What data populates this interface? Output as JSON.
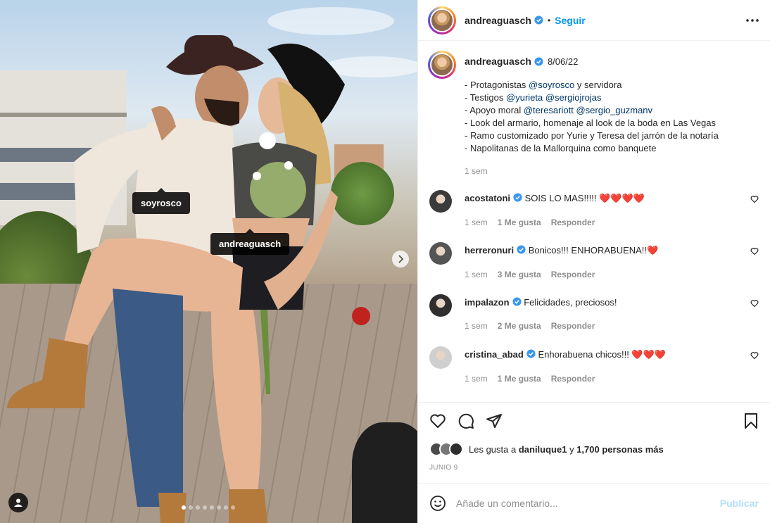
{
  "header": {
    "username": "andreaguasch",
    "separator": "•",
    "follow_label": "Seguir",
    "more_icon": "more-horizontal-icon"
  },
  "caption": {
    "username": "andreaguasch",
    "date": "8/06/22",
    "lines": [
      {
        "before": "- Protagonistas ",
        "mentions": [
          "@soyrosco"
        ],
        "after": " y servidora"
      },
      {
        "before": "- Testigos ",
        "mentions": [
          "@yurieta",
          "@sergiojrojas"
        ],
        "after": ""
      },
      {
        "before": "- Apoyo moral ",
        "mentions": [
          "@teresariott",
          "@sergio_guzmanv"
        ],
        "after": ""
      },
      {
        "before": "- Look del armario, homenaje al look de la boda en Las Vegas",
        "mentions": [],
        "after": ""
      },
      {
        "before": "- Ramo customizado por Yurie y Teresa del jarrón de la notaría",
        "mentions": [],
        "after": ""
      },
      {
        "before": "- Napolitanas de la Mallorquina como banquete",
        "mentions": [],
        "after": ""
      }
    ],
    "time": "1 sem"
  },
  "comments": [
    {
      "username": "acostatoni",
      "text": "SOIS LO MAS!!!!! ❤️❤️❤️❤️",
      "time": "1 sem",
      "likes": "1 Me gusta",
      "reply": "Responder"
    },
    {
      "username": "herreronuri",
      "text": "Bonicos!!! ENHORABUENA!!❤️",
      "time": "1 sem",
      "likes": "3 Me gusta",
      "reply": "Responder"
    },
    {
      "username": "impalazon",
      "text": "Felicidades, preciosos!",
      "time": "1 sem",
      "likes": "2 Me gusta",
      "reply": "Responder"
    },
    {
      "username": "cristina_abad",
      "text": "Enhorabuena chicos!!! ❤️❤️❤️",
      "time": "1 sem",
      "likes": "1 Me gusta",
      "reply": "Responder"
    }
  ],
  "likes": {
    "prefix": "Les gusta a ",
    "user": "daniluque1",
    "middle": " y ",
    "count": "1,700 personas más"
  },
  "date": "JUNIO 9",
  "add_comment": {
    "placeholder": "Añade un comentario...",
    "publish": "Publicar"
  },
  "photo": {
    "tags": [
      "soyrosco",
      "andreaguasch"
    ],
    "carousel_total": 8,
    "carousel_active": 1
  },
  "colors": {
    "accent": "#0095f6",
    "mention": "#00376b",
    "muted": "#8e8e8e",
    "heart": "#ed4956"
  }
}
